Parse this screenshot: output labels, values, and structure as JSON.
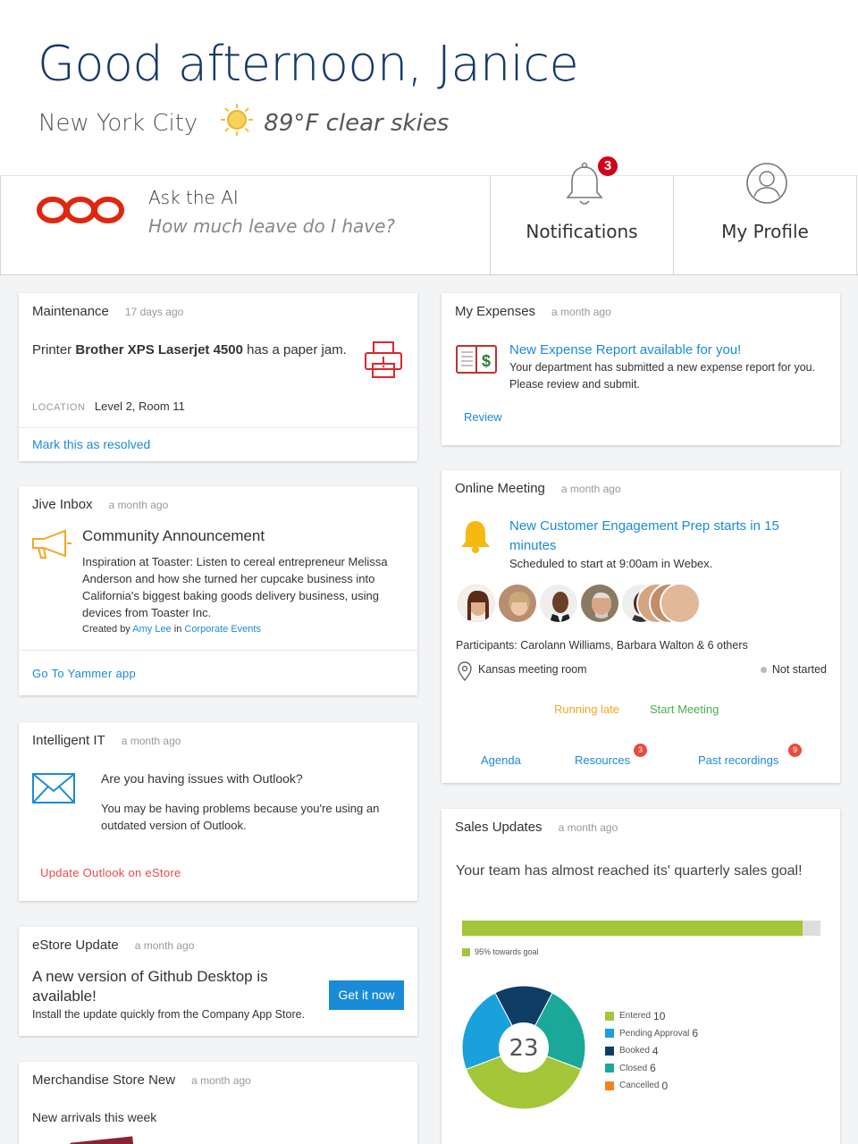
{
  "header": {
    "greeting": "Good afternoon, Janice",
    "city": "New York City",
    "weather": "89°F clear skies",
    "weather_icon": "sun-icon"
  },
  "actions": {
    "ask_title": "Ask the AI",
    "ask_prompt": "How much leave do I have?",
    "notifications_label": "Notifications",
    "notifications_count": "3",
    "profile_label": "My Profile"
  },
  "maintenance": {
    "title": "Maintenance",
    "time": "17 days ago",
    "msg_pre": "Printer ",
    "msg_bold": "Brother XPS Laserjet 4500",
    "msg_post": " has a paper jam.",
    "location_label": "LOCATION",
    "location_value": "Level 2, Room 11",
    "action": "Mark this as resolved"
  },
  "jive": {
    "title": "Jive Inbox",
    "time": "a month ago",
    "heading": "Community Announcement",
    "body": "Inspiration at Toaster: Listen to cereal entrepreneur Melissa Anderson and how she turned her cupcake business into California's biggest baking goods delivery business, using devices from Toaster Inc.",
    "created_by": "Created by",
    "author": "Amy Lee",
    "in": "in",
    "group": "Corporate Events",
    "action": "Go To Yammer app"
  },
  "it": {
    "title": "Intelligent IT",
    "time": "a month ago",
    "heading": "Are you having issues with Outlook?",
    "body": "You may be having problems because you're using an outdated version of Outlook.",
    "action": "Update Outlook on eStore"
  },
  "estore": {
    "title": "eStore Update",
    "time": "a month ago",
    "heading": "A new version of Github Desktop is available!",
    "body": "Install the update quickly from the Company App Store.",
    "button": "Get it now"
  },
  "merch": {
    "title": "Merchandise Store New",
    "time": "a month ago",
    "body": "New arrivals this week"
  },
  "expenses": {
    "title": "My Expenses",
    "time": "a month ago",
    "heading": "New Expense Report available for you!",
    "body": "Your department has submitted a new expense report for you. Please review and submit.",
    "action": "Review"
  },
  "meeting": {
    "title": "Online Meeting",
    "time": "a month ago",
    "heading": "New Customer Engagement Prep starts in 15 minutes",
    "sub": "Scheduled to start at 9:00am in Webex.",
    "participants": "Participants: Carolann Williams, Barbara Walton & 6 others",
    "room": "Kansas meeting room",
    "status": "Not started",
    "late": "Running late",
    "start": "Start Meeting",
    "agenda": "Agenda",
    "resources": "Resources",
    "resources_count": "3",
    "recordings": "Past recordings",
    "recordings_count": "9"
  },
  "sales": {
    "title": "Sales Updates",
    "time": "a month ago",
    "heading": "Your team has almost reached its' quarterly sales goal!",
    "progress_label": "95% towards goal",
    "progress": 0.95,
    "total": "23"
  },
  "chart_data": {
    "type": "pie",
    "categories": [
      "Entered",
      "Pending Approval",
      "Booked",
      "Closed",
      "Cancelled"
    ],
    "values": [
      10,
      6,
      4,
      6,
      0
    ],
    "colors": [
      "#a4c639",
      "#1aa1dc",
      "#0e3e66",
      "#1aa999",
      "#f5821f"
    ],
    "center_label": "23"
  }
}
